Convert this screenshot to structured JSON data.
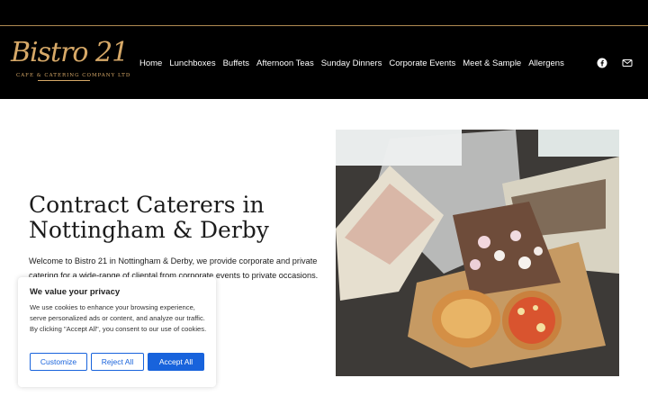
{
  "header": {
    "logo_text": "Bistro 21",
    "logo_subtitle": "CAFE & CATERING COMPANY LTD",
    "nav": [
      {
        "label": "Home"
      },
      {
        "label": "Lunchboxes"
      },
      {
        "label": "Buffets"
      },
      {
        "label": "Afternoon Teas"
      },
      {
        "label": "Sunday Dinners"
      },
      {
        "label": "Corporate Events"
      },
      {
        "label": "Meet & Sample"
      },
      {
        "label": "Allergens"
      }
    ],
    "social": [
      {
        "icon": "facebook-icon"
      },
      {
        "icon": "envelope-icon"
      }
    ]
  },
  "hero": {
    "title": "Contract Caterers in Nottingham & Derby",
    "text": "Welcome to Bistro 21 in Nottingham & Derby, we provide corporate and private catering for a wide-range of cliental from corporate events to private occasions.",
    "image_icon": "lunchbox-photo"
  },
  "cookie": {
    "title": "We value your privacy",
    "text": "We use cookies to enhance your browsing experience, serve personalized ads or content, and analyze our traffic. By clicking \"Accept All\", you consent to our use of cookies.",
    "customize_label": "Customize",
    "reject_label": "Reject All",
    "accept_label": "Accept All"
  },
  "colors": {
    "header_bg": "#000000",
    "gold": "#d7a968",
    "primary_blue": "#1863dc"
  }
}
